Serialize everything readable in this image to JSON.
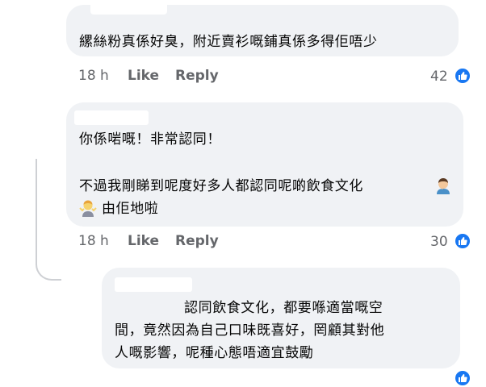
{
  "comments": [
    {
      "text_lines": [
        "縲絲粉真係好臭，附近賣衫嘅鋪真係多得佢唔少"
      ],
      "time": "18 h",
      "like_label": "Like",
      "reply_label": "Reply",
      "like_count": "42"
    },
    {
      "text_lines": [
        "你係啱嘅！非常認同！",
        "",
        "不過我剛睇到呢度好多人都認同呢啲飲食文化",
        "由佢地啦"
      ],
      "emoji_names": [
        "person-facepalming-emoji",
        "person-shrugging-emoji"
      ],
      "time": "18 h",
      "like_label": "Like",
      "reply_label": "Reply",
      "like_count": "30"
    },
    {
      "text_lines": [
        "認同飲食文化，都要喺適當嘅空",
        "間，竟然因為自己口味既喜好，罔顧其對他",
        "人嘅影響，呢種心態唔適宜鼓勵"
      ]
    }
  ],
  "colors": {
    "bubble": "#f0f2f5",
    "meta": "#65676b",
    "like_blue": "#1877f2",
    "thread": "#ced0d4"
  }
}
